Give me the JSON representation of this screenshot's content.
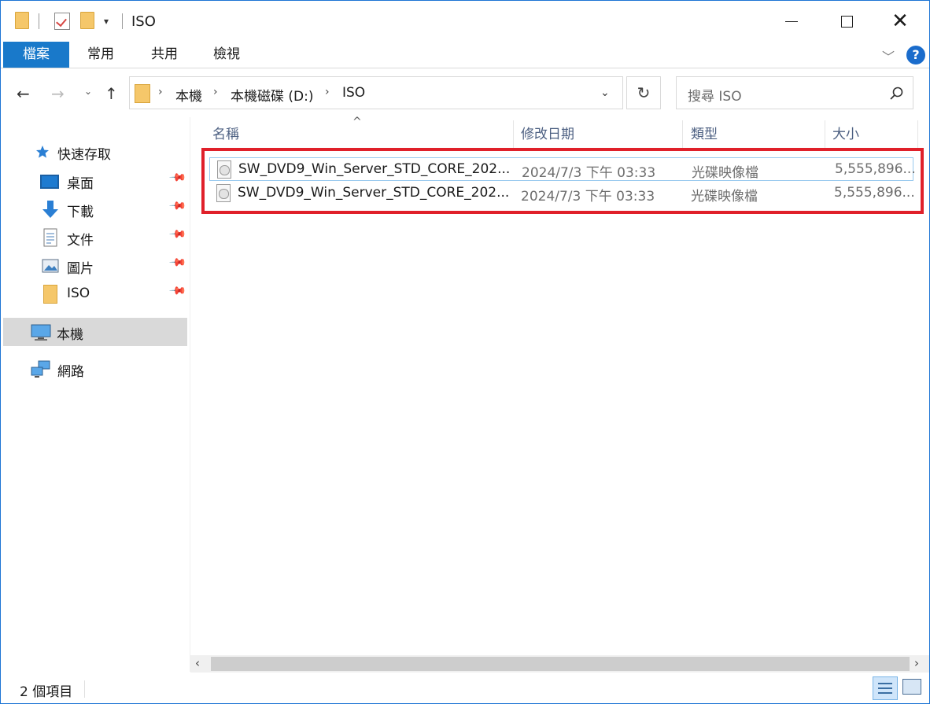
{
  "window": {
    "title": "ISO",
    "controls": {
      "minimize": "",
      "maximize": "",
      "close": "✕"
    }
  },
  "quick_access_toolbar": {
    "dropdown_glyph": "▾"
  },
  "ribbon": {
    "tabs": [
      "檔案",
      "常用",
      "共用",
      "檢視"
    ],
    "active_tab": "檔案",
    "active_color": "#1979ca",
    "expand_glyph": "﹀",
    "help_glyph": "?"
  },
  "navigation": {
    "back_glyph": "←",
    "forward_glyph": "→",
    "recent_glyph": "⌄",
    "up_glyph": "↑",
    "breadcrumb": [
      "本機",
      "本機磁碟 (D:)",
      "ISO"
    ],
    "crumb_separator": "›",
    "address_dropdown_glyph": "⌄",
    "refresh_glyph": "↻",
    "search_placeholder": "搜尋 ISO"
  },
  "sidebar": {
    "quick_access_label": "快速存取",
    "pinned": [
      {
        "label": "桌面",
        "icon": "desktop-icon"
      },
      {
        "label": "下載",
        "icon": "download-icon"
      },
      {
        "label": "文件",
        "icon": "document-icon"
      },
      {
        "label": "圖片",
        "icon": "pictures-icon"
      },
      {
        "label": "ISO",
        "icon": "folder-icon"
      }
    ],
    "pin_glyph": "📌",
    "this_pc_label": "本機",
    "network_label": "網路",
    "selected": "本機"
  },
  "file_list": {
    "sort_glyph": "^",
    "columns": [
      "名稱",
      "修改日期",
      "類型",
      "大小"
    ],
    "rows": [
      {
        "name": "SW_DVD9_Win_Server_STD_CORE_202...",
        "modified": "2024/7/3 下午 03:33",
        "type": "光碟映像檔",
        "size": "5,555,896...",
        "icon": "disc-image-icon"
      },
      {
        "name": "SW_DVD9_Win_Server_STD_CORE_202...",
        "modified": "2024/7/3 下午 03:33",
        "type": "光碟映像檔",
        "size": "5,555,896...",
        "icon": "disc-image-icon"
      }
    ],
    "highlight_color": "#e0202a"
  },
  "scrollbar": {
    "left_glyph": "‹",
    "right_glyph": "›"
  },
  "status_bar": {
    "item_count": "2 個項目"
  }
}
